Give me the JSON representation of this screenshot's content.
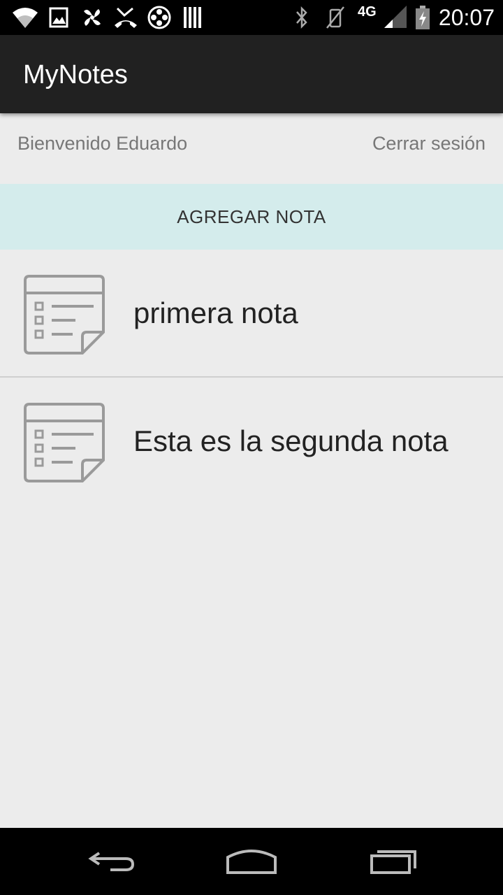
{
  "status_bar": {
    "time": "20:07",
    "network": "4G",
    "left_icons": [
      "wifi-icon",
      "image-icon",
      "pinwheel-icon",
      "missed-call-icon",
      "media-reel-icon",
      "barcode-icon"
    ],
    "right_icons": [
      "bluetooth-icon",
      "vibrate-off-icon",
      "signal-icon",
      "battery-icon"
    ]
  },
  "action_bar": {
    "title": "MyNotes"
  },
  "header": {
    "welcome": "Bienvenido Eduardo",
    "logout": "Cerrar sesión"
  },
  "add_note": {
    "label": "AGREGAR NOTA",
    "color": "#d4ecec"
  },
  "notes": [
    {
      "title": "primera nota",
      "icon": "note-icon"
    },
    {
      "title": "Esta es la segunda nota",
      "icon": "note-icon"
    }
  ],
  "nav_bar": {
    "buttons": [
      "back-icon",
      "home-icon",
      "recent-apps-icon"
    ]
  },
  "colors": {
    "action_bar": "#212121",
    "background": "#ececec",
    "status_bar": "#000000"
  }
}
